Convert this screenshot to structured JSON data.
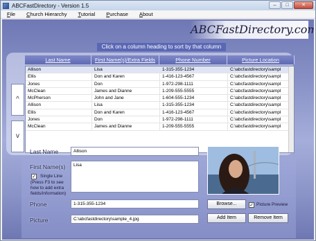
{
  "window": {
    "title": "ABCFastDirectory - Version 1.5",
    "btn_min": "–",
    "btn_max": "□",
    "btn_close": "✕"
  },
  "menu": [
    "File",
    "Church Hierarchy",
    "Tutorial",
    "Purchase",
    "About"
  ],
  "brand": "ABCFastDirectory.com",
  "hint": "Click on a column heading to sort by that column",
  "columns": [
    "Last Name",
    "First Name(s)/Extra Fields",
    "Phone Number",
    "Picture Location"
  ],
  "rows": [
    [
      "Allison",
      "Lisa",
      "1-315-355-1234",
      "C:\\abcfastdirectory\\sampl"
    ],
    [
      "Ellis",
      "Don and Karen",
      "1-416-123-4567",
      "C:\\abcfastdirectory\\sampl"
    ],
    [
      "Jones",
      "Don",
      "1-972-298-1111",
      "C:\\abcfastdirectory\\sampl"
    ],
    [
      "McClean",
      "James and Dianne",
      "1-209-555-5555",
      "C:\\abcfastdirectory\\sampl"
    ],
    [
      "McPherson",
      "John and Jane",
      "1-604-555-1234",
      "C:\\abcfastdirectory\\sampl"
    ],
    [
      "Allison",
      "Lisa",
      "1-315-355-1234",
      "C:\\abcfastdirectory\\sampl"
    ],
    [
      "Ellis",
      "Don and Karen",
      "1-416-123-4567",
      "C:\\abcfastdirectory\\sampl"
    ],
    [
      "Jones",
      "Don",
      "1-972-298-1111",
      "C:\\abcfastdirectory\\sampl"
    ],
    [
      "McClean",
      "James and Dianne",
      "1-209-555-5555",
      "C:\\abcfastdirectory\\sampl"
    ]
  ],
  "nav": {
    "up": "^",
    "down": "v"
  },
  "form": {
    "last_name_label": "Last Name",
    "last_name_value": "Allison",
    "first_names_label": "First Name(s)",
    "first_names_value": "Lisa",
    "single_line_label": "Single Line",
    "single_line_help": "(Press F3 to see how to add extra fields/information)",
    "phone_label": "Phone",
    "phone_value": "1-315-355-1234",
    "picture_label": "Picture",
    "picture_value": "C:\\abcfastdirectory\\sample_4.jpg"
  },
  "buttons": {
    "browse": "Browse...",
    "add": "Add Item",
    "remove": "Remove Item",
    "preview": "Picture Preview"
  }
}
